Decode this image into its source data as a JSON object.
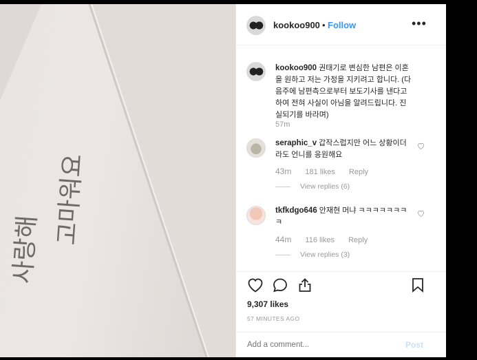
{
  "header": {
    "username": "kookoo900",
    "separator": "•",
    "follow_label": "Follow",
    "more_label": "•••"
  },
  "caption": {
    "username": "kookoo900",
    "text": "권태기로 변심한 남편은 이혼을 원하고 저는 가정을 지키려고 합니다. (다음주에 남편측으로부터 보도기사를 낸다고 하여 전혀 사실이 아님을 알려드립니다. 진실되기를 바라며)",
    "time": "57m"
  },
  "comments": [
    {
      "username": "seraphic_v",
      "text": "갑작스럽지만 어느 상황이더라도 언니를 응원해요",
      "time": "43m",
      "likes": "181 likes",
      "reply_label": "Reply",
      "view_replies": "View replies (6)"
    },
    {
      "username": "tkfkdgo646",
      "text": "안재현 머냐 ㅋㅋㅋㅋㅋㅋㅋㅋ",
      "time": "44m",
      "likes": "116 likes",
      "reply_label": "Reply",
      "view_replies": "View replies (3)"
    }
  ],
  "actions": {
    "likes": "9,307 likes",
    "posted_ago": "57 MINUTES AGO"
  },
  "comment_box": {
    "placeholder": "Add a comment...",
    "post_label": "Post"
  },
  "photo": {
    "handwriting": [
      "사랑해",
      "고마워요"
    ]
  },
  "colors": {
    "accent": "#3897f0",
    "post_disabled": "#c7e0f9",
    "muted": "#999999",
    "text": "#262626"
  }
}
